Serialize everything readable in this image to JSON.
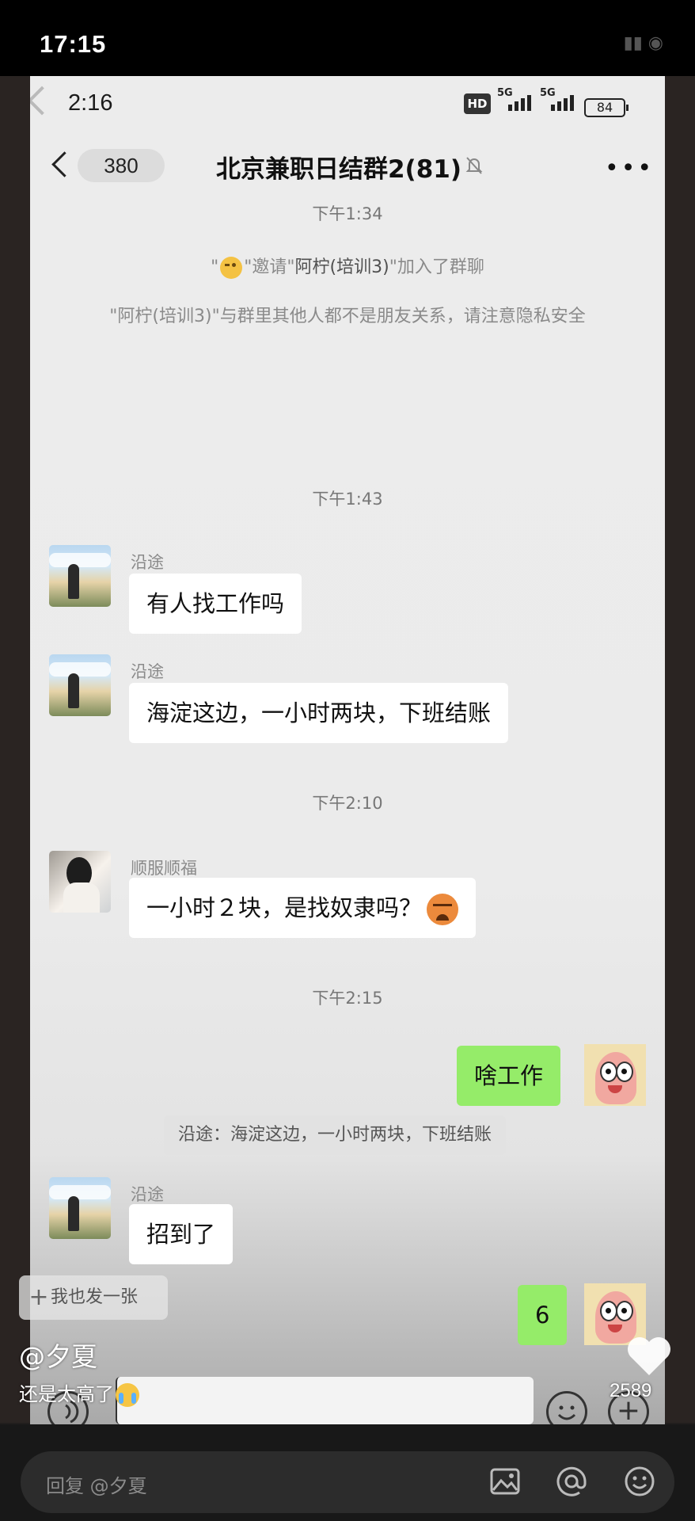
{
  "outer_status": {
    "time": "17:15"
  },
  "inner_status": {
    "time": "2:16",
    "hd": "HD",
    "net1": "5G",
    "net2": "5G",
    "battery": "84"
  },
  "header": {
    "back_count": "380",
    "title": "北京兼职日结群2(81)"
  },
  "system": {
    "time1": "下午1:34",
    "invite_prefix": "\"",
    "invite_mid": "\"邀请\"",
    "invite_name": "阿柠(培训3)",
    "invite_suffix": "\"加入了群聊",
    "privacy_note": "\"阿柠(培训3)\"与群里其他人都不是朋友关系，请注意隐私安全",
    "time2": "下午1:43",
    "time3": "下午2:10",
    "time4": "下午2:15"
  },
  "messages": [
    {
      "sender": "沿途",
      "text": "有人找工作吗"
    },
    {
      "sender": "沿途",
      "text": "海淀这边，一小时两块，下班结账"
    },
    {
      "sender": "顺服顺福",
      "text": "一小时２块，是找奴隶吗？"
    },
    {
      "sender": "",
      "text": "啥工作"
    },
    {
      "quote": "沿途：海淀这边，一小时两块，下班结账"
    },
    {
      "sender": "沿途",
      "text": "招到了"
    },
    {
      "sender": "",
      "text": "6"
    }
  ],
  "post": {
    "add_label": "我也发一张",
    "author": "@夕夏",
    "caption": "还是太高了",
    "likes": "2589"
  },
  "reply": {
    "placeholder": "回复 @夕夏"
  }
}
